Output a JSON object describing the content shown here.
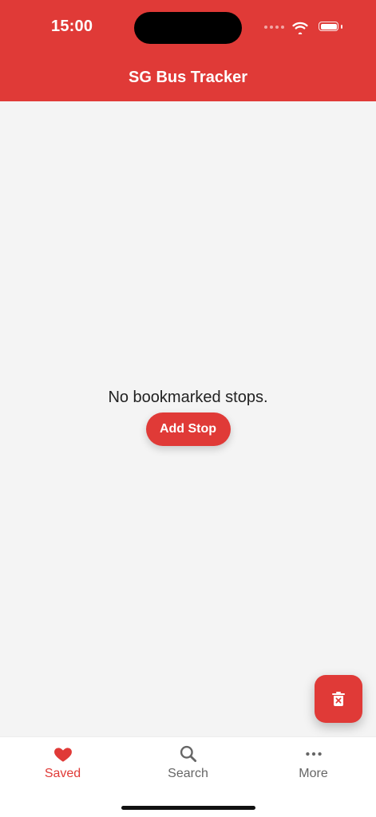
{
  "status_bar": {
    "time": "15:00",
    "battery_level": 1.0
  },
  "header": {
    "title": "SG Bus Tracker"
  },
  "empty_state": {
    "message": "No bookmarked stops.",
    "button_label": "Add Stop"
  },
  "tabs": [
    {
      "label": "Saved",
      "icon": "heart-icon",
      "active": true
    },
    {
      "label": "Search",
      "icon": "search-icon",
      "active": false
    },
    {
      "label": "More",
      "icon": "more-icon",
      "active": false
    }
  ],
  "fab": {
    "icon": "delete-icon"
  },
  "theme": {
    "primary": "#e03a37",
    "background": "#f4f4f4",
    "tab_background": "#ffffff",
    "inactive_text": "#666666"
  }
}
